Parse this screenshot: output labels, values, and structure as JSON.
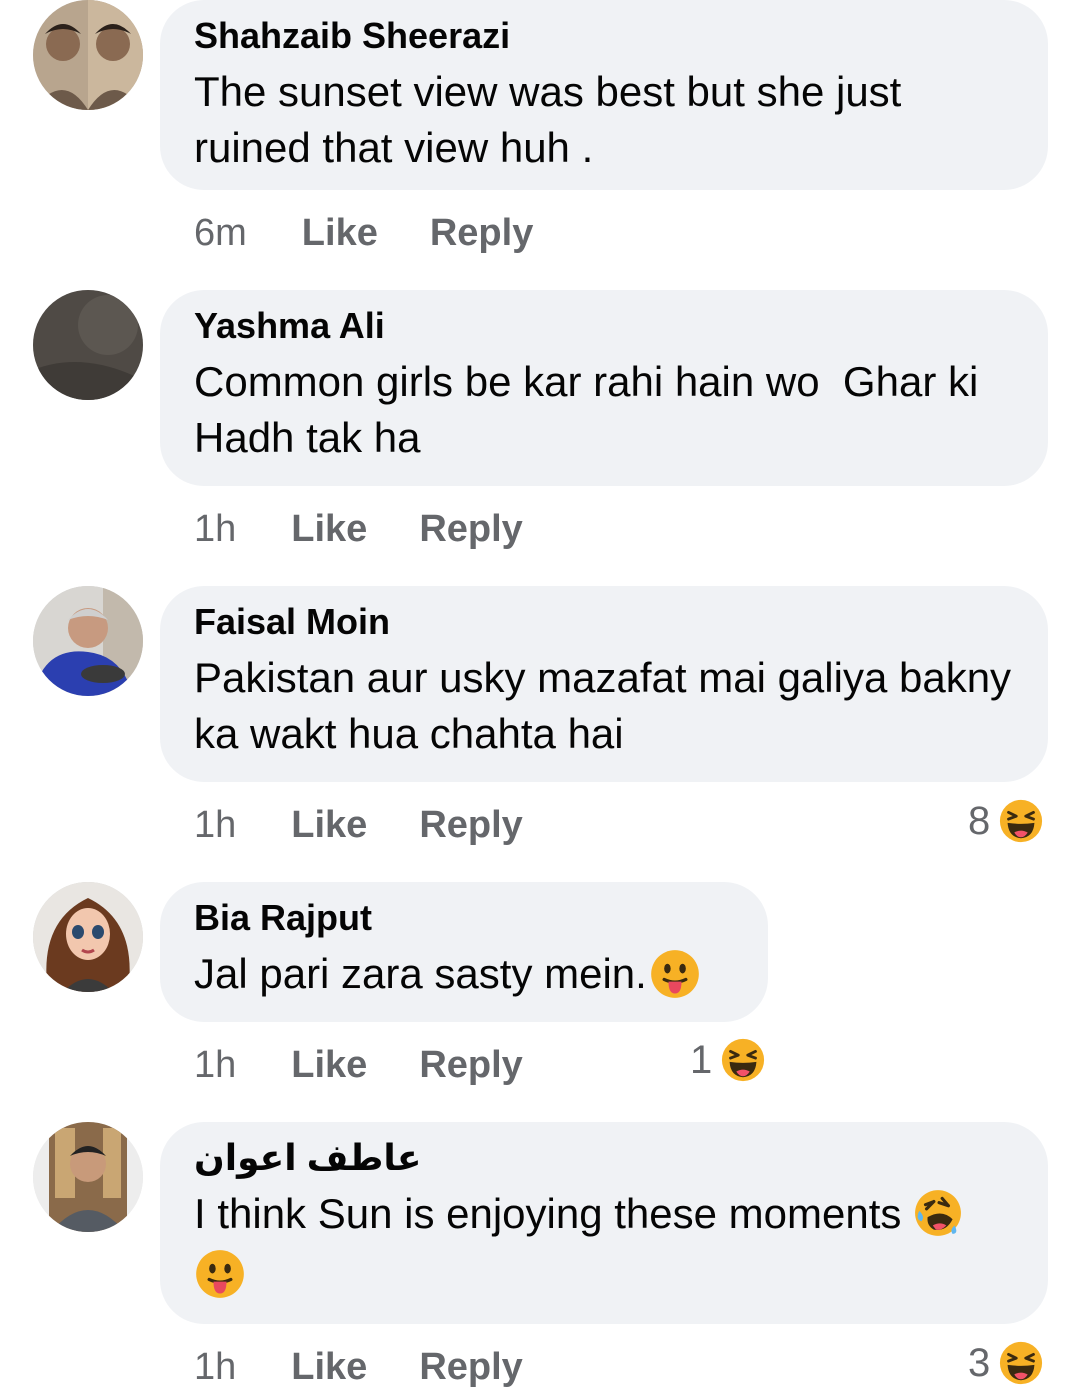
{
  "comments": [
    {
      "author": "Shahzaib Sheerazi",
      "text": "The sunset view was best but she just ruined that view huh .",
      "time": "6m",
      "like": "Like",
      "reply": "Reply",
      "reactions": ""
    },
    {
      "author": "Yashma Ali",
      "text": "Common girls be kar rahi hain wo  Ghar ki Hadh tak ha",
      "time": "1h",
      "like": "Like",
      "reply": "Reply",
      "reactions": ""
    },
    {
      "author": "Faisal Moin",
      "text": "Pakistan aur usky mazafat mai galiya bakny ka wakt hua chahta hai",
      "time": "1h",
      "like": "Like",
      "reply": "Reply",
      "reactions": "8"
    },
    {
      "author": "Bia Rajput",
      "text": "Jal pari zara sasty mein.",
      "time": "1h",
      "like": "Like",
      "reply": "Reply",
      "reactions": "1"
    },
    {
      "author": "عاطف اعوان",
      "text": "I think Sun is enjoying these moments",
      "time": "1h",
      "like": "Like",
      "reply": "Reply",
      "reactions": "3"
    }
  ],
  "icons": {
    "reaction": "haha-reaction-icon",
    "tongue": "tongue-out-emoji-icon",
    "rofl": "rolling-laughing-emoji-icon"
  },
  "colors": {
    "bubble": "#f0f2f5",
    "meta": "#65676b",
    "emoji": "#f7b125"
  }
}
